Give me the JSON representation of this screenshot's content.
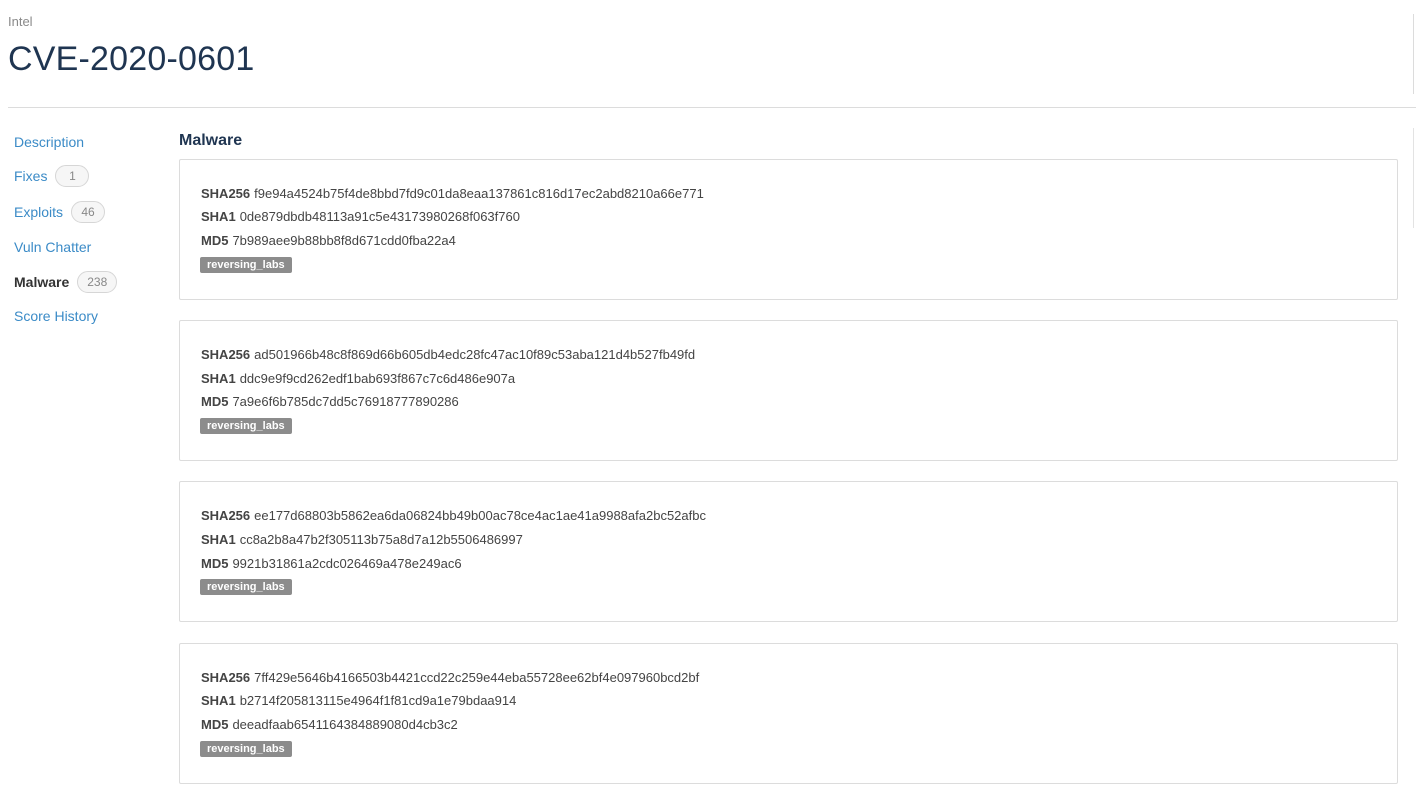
{
  "header": {
    "breadcrumb": "Intel",
    "title": "CVE-2020-0601"
  },
  "sidebar": {
    "items": [
      {
        "label": "Description",
        "count": null
      },
      {
        "label": "Fixes",
        "count": "1"
      },
      {
        "label": "Exploits",
        "count": "46"
      },
      {
        "label": "Vuln Chatter",
        "count": null
      },
      {
        "label": "Malware",
        "count": "238",
        "active": true
      },
      {
        "label": "Score History",
        "count": null
      }
    ]
  },
  "main": {
    "section_title": "Malware",
    "labels": {
      "sha256": "SHA256",
      "sha1": "SHA1",
      "md5": "MD5"
    },
    "cards": [
      {
        "sha256": "f9e94a4524b75f4de8bbd7fd9c01da8eaa137861c816d17ec2abd8210a66e771",
        "sha1": "0de879dbdb48113a91c5e43173980268f063f760",
        "md5": "7b989aee9b88bb8f8d671cdd0fba22a4",
        "tag": "reversing_labs"
      },
      {
        "sha256": "ad501966b48c8f869d66b605db4edc28fc47ac10f89c53aba121d4b527fb49fd",
        "sha1": "ddc9e9f9cd262edf1bab693f867c7c6d486e907a",
        "md5": "7a9e6f6b785dc7dd5c76918777890286",
        "tag": "reversing_labs"
      },
      {
        "sha256": "ee177d68803b5862ea6da06824bb49b00ac78ce4ac1ae41a9988afa2bc52afbc",
        "sha1": "cc8a2b8a47b2f305113b75a8d7a12b5506486997",
        "md5": "9921b31861a2cdc026469a478e249ac6",
        "tag": "reversing_labs"
      },
      {
        "sha256": "7ff429e5646b4166503b4421ccd22c259e44eba55728ee62bf4e097960bcd2bf",
        "sha1": "b2714f205813115e4964f1f81cd9a1e79bdaa914",
        "md5": "deeadfaab6541164384889080d4cb3c2",
        "tag": "reversing_labs"
      }
    ]
  },
  "colors": {
    "title": "#1f3551",
    "link": "#3b8bc7",
    "tag_bg": "#8c8c8c",
    "border": "#dcdcdc"
  }
}
